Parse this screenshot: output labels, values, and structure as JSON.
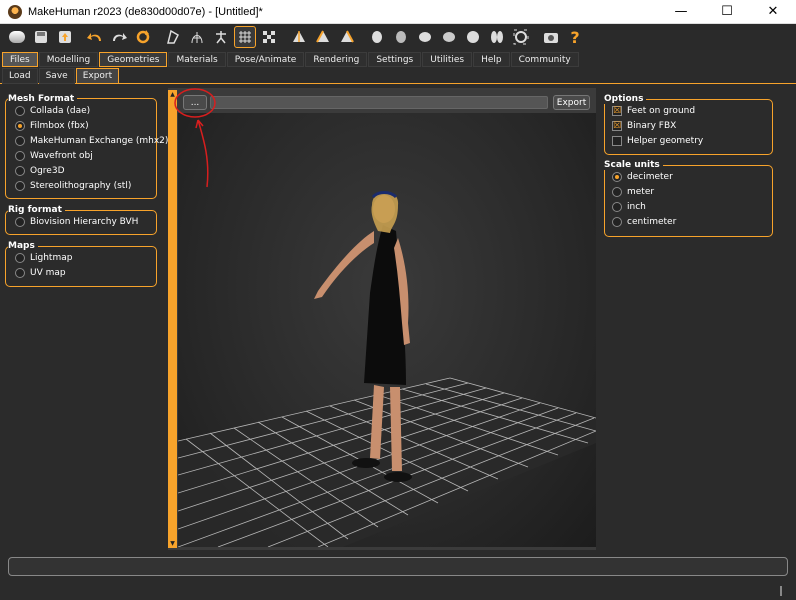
{
  "window": {
    "title": "MakeHuman r2023 (de830d00d07e) - [Untitled]*",
    "minimize": "—",
    "maximize": "☐",
    "close": "✕"
  },
  "toolbar": {
    "icons": [
      "file-icon",
      "save-icon",
      "export-icon",
      "undo-icon",
      "redo-icon",
      "reset-icon",
      "pose-icon",
      "wireframe-icon",
      "skeleton-icon",
      "grid-icon",
      "checker-icon",
      "front-view-icon",
      "left-view-icon",
      "right-view-icon",
      "face-front-icon",
      "face-back-icon",
      "face-left-icon",
      "face-right-icon",
      "top-icon",
      "bottom-icon",
      "frame-icon",
      "screenshot-icon",
      "help-icon"
    ]
  },
  "tabs": [
    "Files",
    "Modelling",
    "Geometries",
    "Materials",
    "Pose/Animate",
    "Rendering",
    "Settings",
    "Utilities",
    "Help",
    "Community"
  ],
  "subtabs": [
    "Load",
    "Save",
    "Export"
  ],
  "mesh_format": {
    "title": "Mesh Format",
    "options": [
      "Collada (dae)",
      "Filmbox (fbx)",
      "MakeHuman Exchange (mhx2)",
      "Wavefront obj",
      "Ogre3D",
      "Stereolithography (stl)"
    ],
    "selected": "Filmbox (fbx)"
  },
  "rig_format": {
    "title": "Rig format",
    "options": [
      "Biovision Hierarchy BVH"
    ]
  },
  "maps": {
    "title": "Maps",
    "options": [
      "Lightmap",
      "UV map"
    ]
  },
  "export_bar": {
    "browse_label": "...",
    "path_value": "",
    "export_label": "Export"
  },
  "options": {
    "title": "Options",
    "items": [
      {
        "label": "Feet on ground",
        "checked": true
      },
      {
        "label": "Binary FBX",
        "checked": true
      },
      {
        "label": "Helper geometry",
        "checked": false
      }
    ]
  },
  "scale_units": {
    "title": "Scale units",
    "options": [
      "decimeter",
      "meter",
      "inch",
      "centimeter"
    ],
    "selected": "decimeter"
  },
  "colors": {
    "accent": "#f7a32b",
    "annotation": "#d81e1e"
  }
}
